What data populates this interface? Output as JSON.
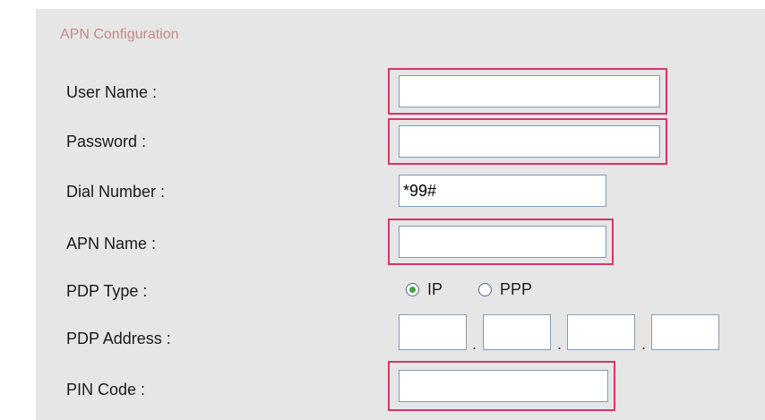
{
  "section": {
    "title": "APN Configuration"
  },
  "fields": {
    "user_name": {
      "label": "User Name :",
      "value": ""
    },
    "password": {
      "label": "Password :",
      "value": ""
    },
    "dial_number": {
      "label": "Dial Number :",
      "value": "*99#"
    },
    "apn_name": {
      "label": "APN Name :",
      "value": ""
    },
    "pdp_type": {
      "label": "PDP Type :",
      "options": [
        {
          "label": "IP",
          "selected": true
        },
        {
          "label": "PPP",
          "selected": false
        }
      ]
    },
    "pdp_address": {
      "label": "PDP Address :",
      "octets": [
        "",
        "",
        "",
        ""
      ],
      "separator": "."
    },
    "pin_code": {
      "label": "PIN Code :",
      "value": ""
    }
  },
  "highlight_color": "#d6336c"
}
